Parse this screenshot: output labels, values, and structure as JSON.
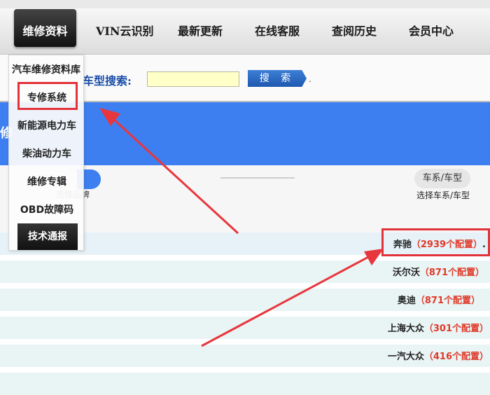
{
  "nav": {
    "items": [
      {
        "label": "维修资料",
        "active": true
      },
      {
        "label": "VIN云识别"
      },
      {
        "label": "最新更新"
      },
      {
        "label": "在线客服"
      },
      {
        "label": "查阅历史"
      },
      {
        "label": "会员中心"
      }
    ]
  },
  "search": {
    "label": "车型搜索:",
    "input_value": "",
    "button_label": "搜 索",
    "suffix": "."
  },
  "banner": {
    "text": "修"
  },
  "steps": {
    "left_label": "选择品牌",
    "right_pill": "车系/车型",
    "right_label": "选择车系/车型"
  },
  "dropdown": {
    "header": "汽车维修资料库",
    "items": [
      "专修系统",
      "新能源电力车",
      "柴油动力车",
      "维修专辑",
      "OBD故障码",
      "技术通报"
    ]
  },
  "brands": [
    {
      "name": "奔驰",
      "count": "（2939个配置）",
      "suffix": "."
    },
    {
      "name": "沃尔沃",
      "count": "（871个配置）"
    },
    {
      "name": "奥迪",
      "count": "（871个配置）"
    },
    {
      "name": "上海大众",
      "count": "（301个配置）"
    },
    {
      "name": "一汽大众",
      "count": "（416个配置）"
    }
  ],
  "colors": {
    "accent_blue": "#3d7ff0",
    "highlight_red": "#e2323a",
    "count_red": "#e03a2a",
    "search_input_bg": "#ffffc8"
  }
}
